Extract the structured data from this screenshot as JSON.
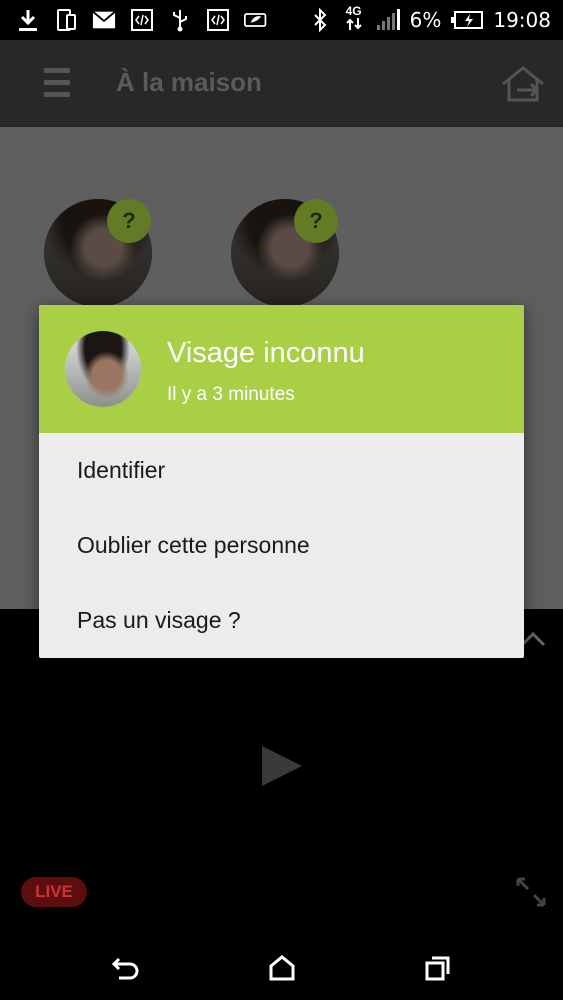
{
  "status_bar": {
    "battery": "6%",
    "time": "19:08",
    "network": "4G"
  },
  "app_bar": {
    "title": "À la maison"
  },
  "faces": [
    {
      "badge": "?"
    },
    {
      "badge": "?"
    }
  ],
  "dialog": {
    "title": "Visage inconnu",
    "subtitle": "Il y a 3 minutes",
    "items": [
      {
        "label": "Identifier"
      },
      {
        "label": "Oublier cette personne"
      },
      {
        "label": "Pas un visage ?"
      }
    ]
  },
  "video": {
    "live_label": "LIVE"
  },
  "colors": {
    "accent": "#a8cf45",
    "badge": "#637b24",
    "live": "#5c0d0f"
  }
}
